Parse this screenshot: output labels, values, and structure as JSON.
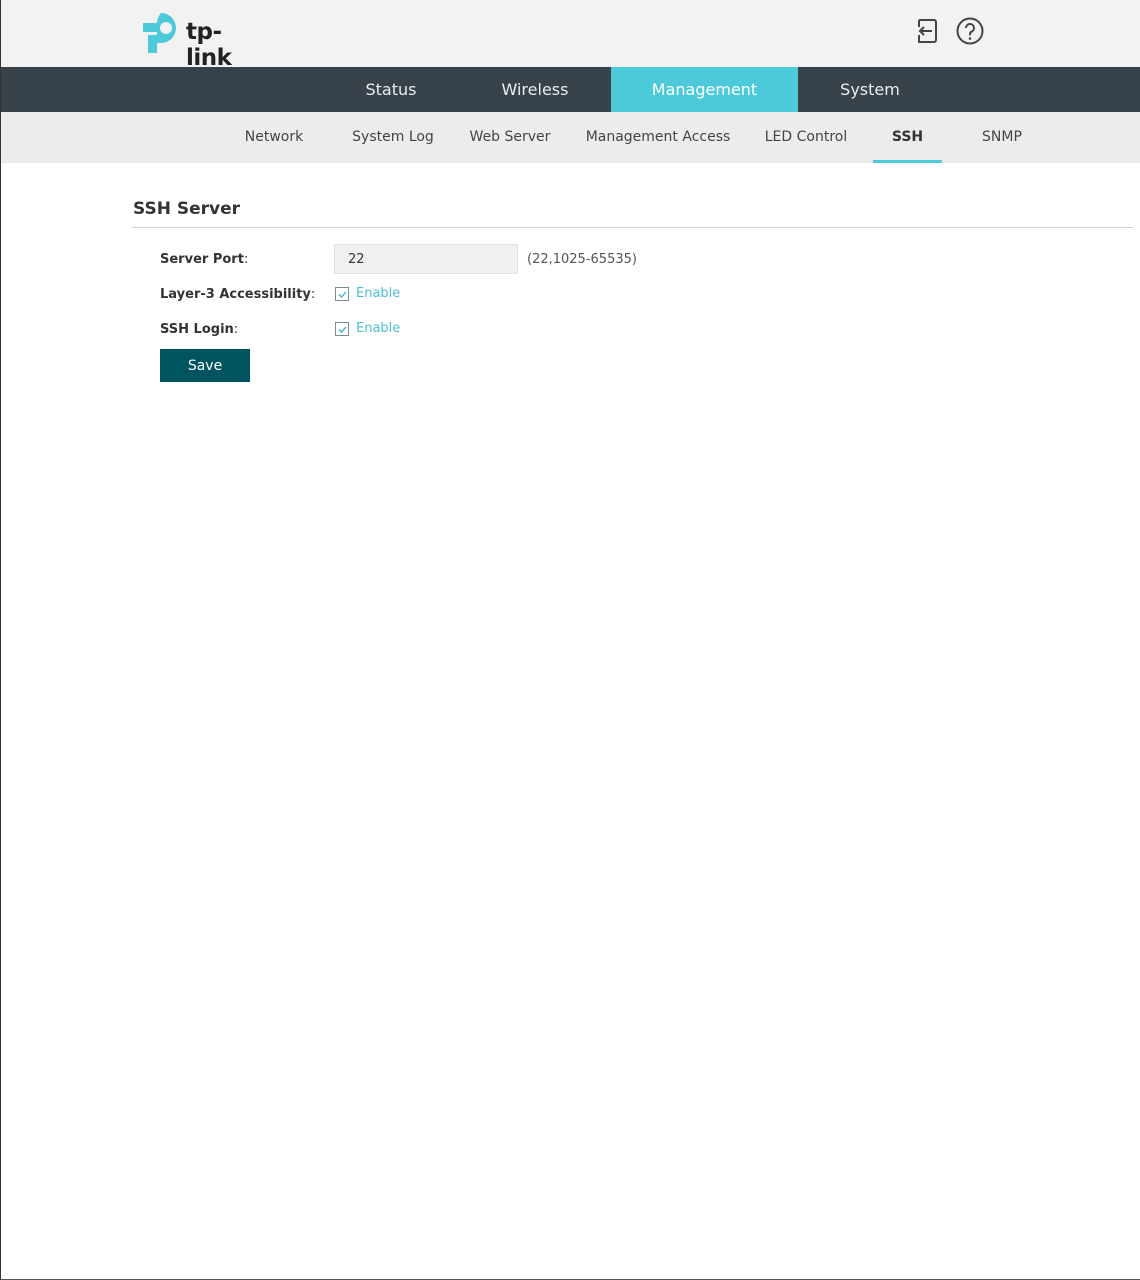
{
  "brand": {
    "name": "tp-link",
    "accent": "#4dcad9",
    "nav_bg": "#37424a",
    "button_bg": "#00545f"
  },
  "header": {
    "icons": [
      "logout-icon",
      "help-icon"
    ]
  },
  "main_nav": {
    "tabs": [
      {
        "label": "Status"
      },
      {
        "label": "Wireless"
      },
      {
        "label": "Management"
      },
      {
        "label": "System"
      }
    ],
    "active": "Management"
  },
  "sub_nav": {
    "tabs": [
      {
        "label": "Network"
      },
      {
        "label": "System Log"
      },
      {
        "label": "Web Server"
      },
      {
        "label": "Management Access"
      },
      {
        "label": "LED Control"
      },
      {
        "label": "SSH"
      },
      {
        "label": "SNMP"
      }
    ],
    "active": "SSH"
  },
  "section": {
    "title": "SSH Server",
    "fields": {
      "server_port": {
        "label": "Server Port",
        "value": "22",
        "hint": "(22,1025-65535)"
      },
      "layer3": {
        "label": "Layer-3 Accessibility",
        "checkbox_label": "Enable",
        "checked": true
      },
      "ssh_login": {
        "label": "SSH Login",
        "checkbox_label": "Enable",
        "checked": true
      }
    },
    "colon": ":",
    "save_label": "Save"
  }
}
